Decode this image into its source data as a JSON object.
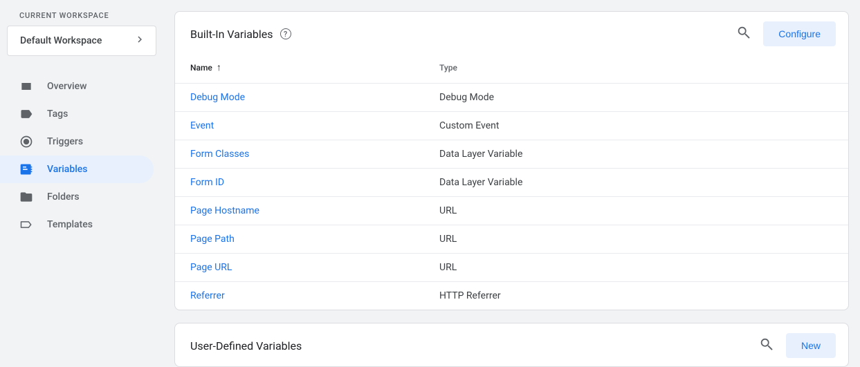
{
  "workspace": {
    "section_label": "CURRENT WORKSPACE",
    "current": "Default Workspace"
  },
  "nav": {
    "items": [
      {
        "id": "overview",
        "label": "Overview"
      },
      {
        "id": "tags",
        "label": "Tags"
      },
      {
        "id": "triggers",
        "label": "Triggers"
      },
      {
        "id": "variables",
        "label": "Variables"
      },
      {
        "id": "folders",
        "label": "Folders"
      },
      {
        "id": "templates",
        "label": "Templates"
      }
    ],
    "active": "variables"
  },
  "builtin": {
    "title": "Built-In Variables",
    "configure_label": "Configure",
    "columns": {
      "name": "Name",
      "type": "Type"
    },
    "rows": [
      {
        "name": "Debug Mode",
        "type": "Debug Mode"
      },
      {
        "name": "Event",
        "type": "Custom Event"
      },
      {
        "name": "Form Classes",
        "type": "Data Layer Variable"
      },
      {
        "name": "Form ID",
        "type": "Data Layer Variable"
      },
      {
        "name": "Page Hostname",
        "type": "URL"
      },
      {
        "name": "Page Path",
        "type": "URL"
      },
      {
        "name": "Page URL",
        "type": "URL"
      },
      {
        "name": "Referrer",
        "type": "HTTP Referrer"
      }
    ]
  },
  "userdef": {
    "title": "User-Defined Variables",
    "new_label": "New"
  }
}
